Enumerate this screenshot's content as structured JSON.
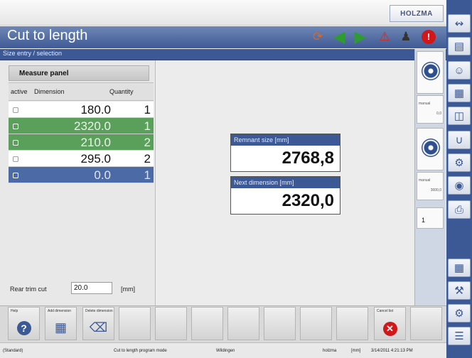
{
  "brand": "HOLZMA",
  "title": "Cut to length",
  "section_title": "Size entry / selection",
  "measure_panel": {
    "header": "Measure panel",
    "columns": [
      "active",
      "Dimension",
      "Quantity"
    ],
    "rows": [
      {
        "dimension": "180.0",
        "quantity": "1",
        "state": "white"
      },
      {
        "dimension": "2320.0",
        "quantity": "1",
        "state": "green"
      },
      {
        "dimension": "210.0",
        "quantity": "2",
        "state": "green"
      },
      {
        "dimension": "295.0",
        "quantity": "2",
        "state": "white"
      },
      {
        "dimension": "0.0",
        "quantity": "1",
        "state": "blue"
      }
    ]
  },
  "rear_trim": {
    "label": "Rear trim cut",
    "value": "20.0",
    "unit": "[mm]"
  },
  "remnant": {
    "label": "Remnant size [mm]",
    "value": "2768,8"
  },
  "next_dim": {
    "label": "Next dimension [mm]",
    "value": "2320,0"
  },
  "right_panel": {
    "mode1": "manual",
    "value1": "0,0",
    "mode2": "manual",
    "value2": "3000,0",
    "counter": "1"
  },
  "bottom_buttons": {
    "help": "Help",
    "add": "Add dimension",
    "delete": "Delete dimension",
    "cancel": "Cancel list"
  },
  "status": {
    "left": "(Standard)",
    "program": "Cut to length program mode",
    "location": "Wildingen",
    "user": "holzma",
    "unit": "[mm]",
    "datetime": "3/14/2011 4:21:13 PM"
  },
  "colors": {
    "accent": "#3c5895",
    "active_row": "#5aa05a",
    "selected_row": "#4c6aa6"
  }
}
